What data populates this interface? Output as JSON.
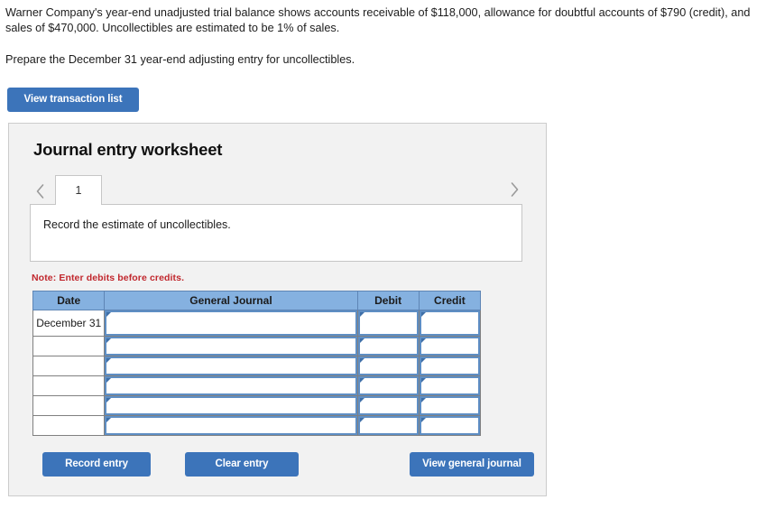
{
  "problem": {
    "statement": "Warner Company's year-end unadjusted trial balance shows accounts receivable of $118,000, allowance for doubtful accounts of $790 (credit), and sales of $470,000. Uncollectibles are estimated to be 1% of sales.",
    "prompt": "Prepare the December 31 year-end adjusting entry for uncollectibles."
  },
  "actions": {
    "view_transaction_list": "View transaction list"
  },
  "worksheet": {
    "title": "Journal entry worksheet",
    "prev_arrow_icon": "chevron-left-icon",
    "next_arrow_icon": "chevron-right-icon",
    "tabs": [
      {
        "label": "1",
        "active": true
      }
    ],
    "description": "Record the estimate of uncollectibles.",
    "note": "Note: Enter debits before credits.",
    "table": {
      "headers": [
        "Date",
        "General Journal",
        "Debit",
        "Credit"
      ],
      "rows": [
        {
          "date": "December 31",
          "general_journal": "",
          "debit": "",
          "credit": ""
        },
        {
          "date": "",
          "general_journal": "",
          "debit": "",
          "credit": ""
        },
        {
          "date": "",
          "general_journal": "",
          "debit": "",
          "credit": ""
        },
        {
          "date": "",
          "general_journal": "",
          "debit": "",
          "credit": ""
        },
        {
          "date": "",
          "general_journal": "",
          "debit": "",
          "credit": ""
        },
        {
          "date": "",
          "general_journal": "",
          "debit": "",
          "credit": ""
        }
      ]
    },
    "buttons": {
      "record_entry": "Record entry",
      "clear_entry": "Clear entry",
      "view_general_journal": "View general journal"
    }
  },
  "colors": {
    "button_blue": "#3c74ba",
    "table_header_blue": "#85b1e0",
    "note_red": "#c1272d",
    "panel_bg": "#f2f2f2",
    "cell_outline_blue": "#5e8ec4"
  }
}
